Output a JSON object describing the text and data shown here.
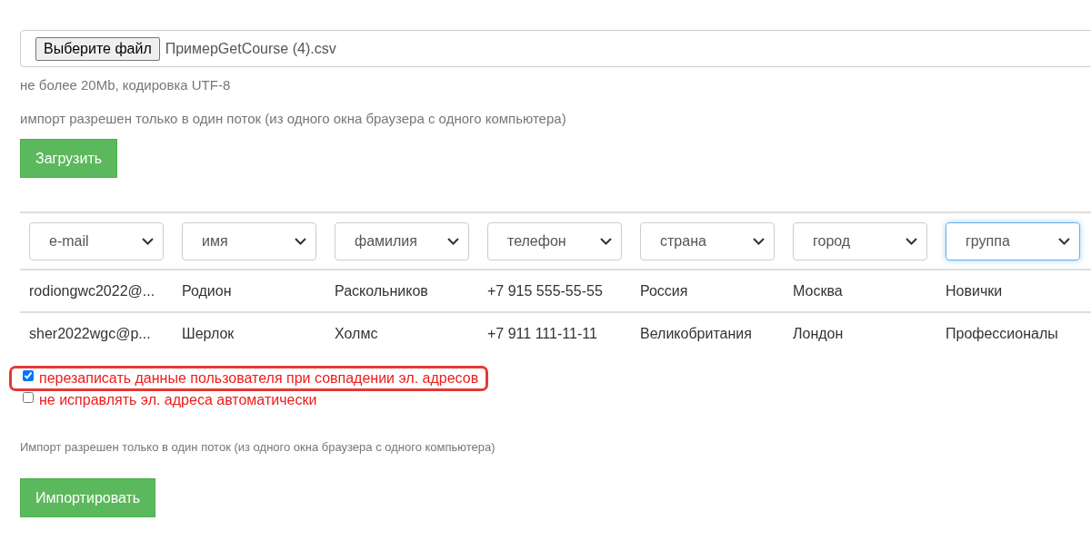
{
  "file_input": {
    "button": "Выберите файл",
    "filename": "ПримерGetCourse (4).csv"
  },
  "hint": "не более 20Mb, кодировка UTF-8",
  "notice": "импорт разрешен только в один поток (из одного окна браузера с одного компьютера)",
  "upload_button": "Загрузить",
  "table": {
    "columns": [
      {
        "label": "e-mail",
        "focused": false
      },
      {
        "label": "имя",
        "focused": false
      },
      {
        "label": "фамилия",
        "focused": false
      },
      {
        "label": "телефон",
        "focused": false
      },
      {
        "label": "страна",
        "focused": false
      },
      {
        "label": "город",
        "focused": false
      },
      {
        "label": "группа",
        "focused": true
      }
    ],
    "rows": [
      [
        "rodiongwc2022@...",
        "Родион",
        "Раскольников",
        "+7 915 555-55-55",
        "Россия",
        "Москва",
        "Новички"
      ],
      [
        "sher2022wgc@p...",
        "Шерлок",
        "Холмс",
        "+7 911 111-11-11",
        "Великобритания",
        "Лондон",
        "Профессионалы"
      ]
    ]
  },
  "options": [
    {
      "label": "перезаписать данные пользователя при совпадении эл. адресов",
      "checked": true,
      "highlighted": true
    },
    {
      "label": "не исправлять эл. адреса автоматически",
      "checked": false,
      "highlighted": false
    }
  ],
  "footer_notice": "Импорт разрешен только в один поток (из одного окна браузера с одного компьютера)",
  "import_button": "Импортировать"
}
